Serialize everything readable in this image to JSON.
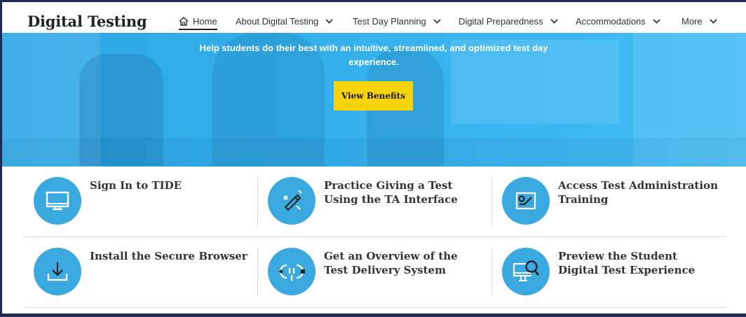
{
  "header": {
    "logo": "Digital Testing",
    "nav": [
      {
        "label": "Home",
        "has_chevron": false,
        "active": true
      },
      {
        "label": "About Digital Testing",
        "has_chevron": true
      },
      {
        "label": "Test Day Planning",
        "has_chevron": true
      },
      {
        "label": "Digital Preparedness",
        "has_chevron": true
      },
      {
        "label": "Accommodations",
        "has_chevron": true
      },
      {
        "label": "More",
        "has_chevron": true
      }
    ],
    "chevron_glyph": "⌄"
  },
  "hero": {
    "text": "Help students do their best with an intuitive, streamlined, and optimized test day experience.",
    "button_label": "View Benefits",
    "button_color": "#f8d20a",
    "background_color": "#34b0ec"
  },
  "cards": [
    {
      "label": "Sign In to TIDE",
      "icon": "monitor-icon"
    },
    {
      "label": "Practice Giving a Test Using the TA Interface",
      "icon": "pencil-edit-icon"
    },
    {
      "label": "Access Test Administration Training",
      "icon": "training-board-icon"
    },
    {
      "label": "Install the Secure Browser",
      "icon": "download-icon"
    },
    {
      "label": "Get an Overview of the Test Delivery System",
      "icon": "plug-connection-icon"
    },
    {
      "label": "Preview the Student Digital Test Experience",
      "icon": "monitor-search-icon"
    }
  ],
  "colors": {
    "icon_circle": "#3aa9e0",
    "frame_border": "#1f2a52"
  }
}
